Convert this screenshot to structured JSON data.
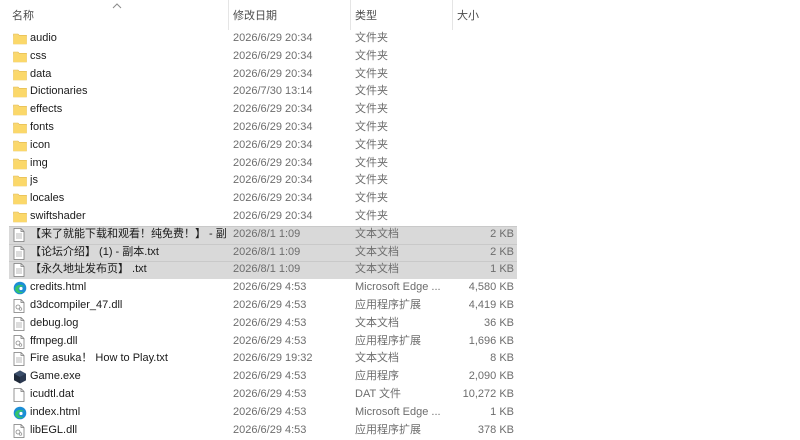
{
  "columns": {
    "name": "名称",
    "date": "修改日期",
    "type": "类型",
    "size": "大小"
  },
  "rows": [
    {
      "name": "audio",
      "date": "2026/6/29 20:34",
      "type": "文件夹",
      "size": "",
      "icon": "folder-icon",
      "selected": false
    },
    {
      "name": "css",
      "date": "2026/6/29 20:34",
      "type": "文件夹",
      "size": "",
      "icon": "folder-icon",
      "selected": false
    },
    {
      "name": "data",
      "date": "2026/6/29 20:34",
      "type": "文件夹",
      "size": "",
      "icon": "folder-icon",
      "selected": false
    },
    {
      "name": "Dictionaries",
      "date": "2026/7/30 13:14",
      "type": "文件夹",
      "size": "",
      "icon": "folder-icon",
      "selected": false
    },
    {
      "name": "effects",
      "date": "2026/6/29 20:34",
      "type": "文件夹",
      "size": "",
      "icon": "folder-icon",
      "selected": false
    },
    {
      "name": "fonts",
      "date": "2026/6/29 20:34",
      "type": "文件夹",
      "size": "",
      "icon": "folder-icon",
      "selected": false
    },
    {
      "name": "icon",
      "date": "2026/6/29 20:34",
      "type": "文件夹",
      "size": "",
      "icon": "folder-icon",
      "selected": false
    },
    {
      "name": "img",
      "date": "2026/6/29 20:34",
      "type": "文件夹",
      "size": "",
      "icon": "folder-icon",
      "selected": false
    },
    {
      "name": "js",
      "date": "2026/6/29 20:34",
      "type": "文件夹",
      "size": "",
      "icon": "folder-icon",
      "selected": false
    },
    {
      "name": "locales",
      "date": "2026/6/29 20:34",
      "type": "文件夹",
      "size": "",
      "icon": "folder-icon",
      "selected": false
    },
    {
      "name": "swiftshader",
      "date": "2026/6/29 20:34",
      "type": "文件夹",
      "size": "",
      "icon": "folder-icon",
      "selected": false
    },
    {
      "name": "【来了就能下载和观看！纯免费！】 - 副...",
      "date": "2026/8/1 1:09",
      "type": "文本文档",
      "size": "2 KB",
      "icon": "text-file-icon",
      "selected": true
    },
    {
      "name": "【论坛介绍】 (1) - 副本.txt",
      "date": "2026/8/1 1:09",
      "type": "文本文档",
      "size": "2 KB",
      "icon": "text-file-icon",
      "selected": true
    },
    {
      "name": "【永久地址发布页】 .txt",
      "date": "2026/8/1 1:09",
      "type": "文本文档",
      "size": "1 KB",
      "icon": "text-file-icon",
      "selected": true
    },
    {
      "name": "credits.html",
      "date": "2026/6/29 4:53",
      "type": "Microsoft Edge ...",
      "size": "4,580 KB",
      "icon": "edge-icon",
      "selected": false
    },
    {
      "name": "d3dcompiler_47.dll",
      "date": "2026/6/29 4:53",
      "type": "应用程序扩展",
      "size": "4,419 KB",
      "icon": "dll-file-icon",
      "selected": false
    },
    {
      "name": "debug.log",
      "date": "2026/6/29 4:53",
      "type": "文本文档",
      "size": "36 KB",
      "icon": "text-file-icon",
      "selected": false
    },
    {
      "name": "ffmpeg.dll",
      "date": "2026/6/29 4:53",
      "type": "应用程序扩展",
      "size": "1,696 KB",
      "icon": "dll-file-icon",
      "selected": false
    },
    {
      "name": "Fire asuka！ How to Play.txt",
      "date": "2026/6/29 19:32",
      "type": "文本文档",
      "size": "8 KB",
      "icon": "text-file-icon",
      "selected": false
    },
    {
      "name": "Game.exe",
      "date": "2026/6/29 4:53",
      "type": "应用程序",
      "size": "2,090 KB",
      "icon": "game-exe-icon",
      "selected": false
    },
    {
      "name": "icudtl.dat",
      "date": "2026/6/29 4:53",
      "type": "DAT 文件",
      "size": "10,272 KB",
      "icon": "blank-file-icon",
      "selected": false
    },
    {
      "name": "index.html",
      "date": "2026/6/29 4:53",
      "type": "Microsoft Edge ...",
      "size": "1 KB",
      "icon": "edge-icon",
      "selected": false
    },
    {
      "name": "libEGL.dll",
      "date": "2026/6/29 4:53",
      "type": "应用程序扩展",
      "size": "378 KB",
      "icon": "dll-file-icon",
      "selected": false
    }
  ]
}
